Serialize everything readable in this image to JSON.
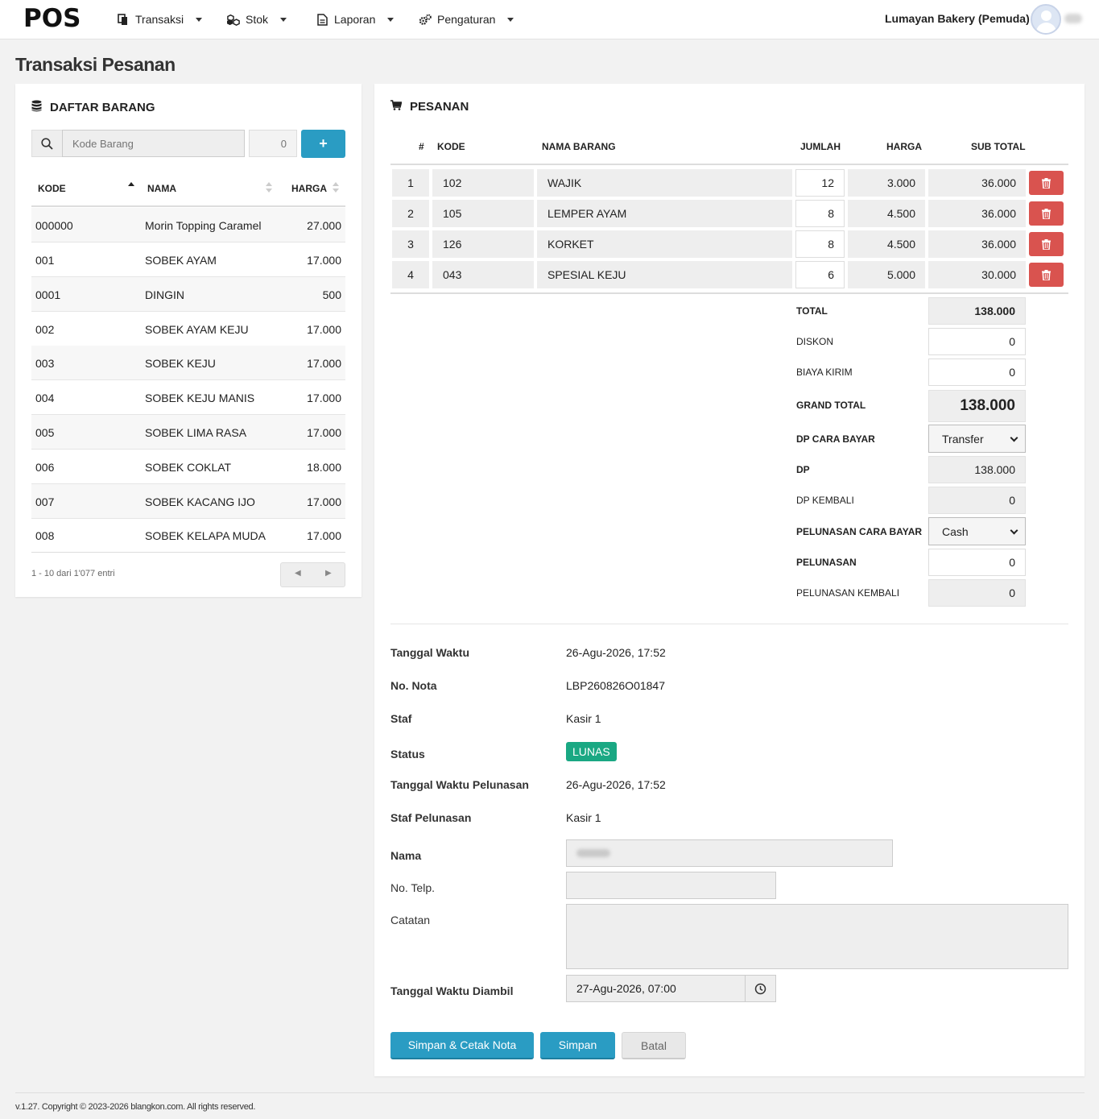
{
  "navbar": {
    "brand": "POS",
    "menu": [
      {
        "label": "Transaksi",
        "icon": "file-copy-icon"
      },
      {
        "label": "Stok",
        "icon": "cubes-icon"
      },
      {
        "label": "Laporan",
        "icon": "file-text-icon"
      },
      {
        "label": "Pengaturan",
        "icon": "cogs-icon"
      }
    ],
    "store_name": "Lumayan Bakery (Pemuda)"
  },
  "page_title": "Transaksi Pesanan",
  "item_list": {
    "title": "DAFTAR BARANG",
    "search_placeholder": "Kode Barang",
    "qty_value": "0",
    "add_label": "+",
    "columns": [
      "KODE",
      "NAMA",
      "HARGA"
    ],
    "rows": [
      {
        "kode": "000000",
        "nama": "Morin Topping Caramel",
        "harga": "27.000"
      },
      {
        "kode": "001",
        "nama": "SOBEK AYAM",
        "harga": "17.000"
      },
      {
        "kode": "0001",
        "nama": "DINGIN",
        "harga": "500"
      },
      {
        "kode": "002",
        "nama": "SOBEK AYAM KEJU",
        "harga": "17.000"
      },
      {
        "kode": "003",
        "nama": "SOBEK KEJU",
        "harga": "17.000"
      },
      {
        "kode": "004",
        "nama": "SOBEK KEJU MANIS",
        "harga": "17.000"
      },
      {
        "kode": "005",
        "nama": "SOBEK LIMA RASA",
        "harga": "17.000"
      },
      {
        "kode": "006",
        "nama": "SOBEK COKLAT",
        "harga": "18.000"
      },
      {
        "kode": "007",
        "nama": "SOBEK KACANG IJO",
        "harga": "17.000"
      },
      {
        "kode": "008",
        "nama": "SOBEK KELAPA MUDA",
        "harga": "17.000"
      }
    ],
    "info": "1 - 10 dari 1'077 entri"
  },
  "order": {
    "title": "PESANAN",
    "columns": [
      "#",
      "KODE",
      "NAMA BARANG",
      "JUMLAH",
      "HARGA",
      "SUB TOTAL"
    ],
    "rows": [
      {
        "no": "1",
        "kode": "102",
        "nama": "WAJIK",
        "jumlah": "12",
        "harga": "3.000",
        "subtotal": "36.000"
      },
      {
        "no": "2",
        "kode": "105",
        "nama": "LEMPER AYAM",
        "jumlah": "8",
        "harga": "4.500",
        "subtotal": "36.000"
      },
      {
        "no": "3",
        "kode": "126",
        "nama": "KORKET",
        "jumlah": "8",
        "harga": "4.500",
        "subtotal": "36.000"
      },
      {
        "no": "4",
        "kode": "043",
        "nama": "SPESIAL KEJU",
        "jumlah": "6",
        "harga": "5.000",
        "subtotal": "30.000"
      }
    ],
    "summary": {
      "total_label": "TOTAL",
      "total": "138.000",
      "diskon_label": "DISKON",
      "diskon": "0",
      "biaya_kirim_label": "BIAYA KIRIM",
      "biaya_kirim": "0",
      "grand_total_label": "GRAND TOTAL",
      "grand_total": "138.000",
      "dp_cara_bayar_label": "DP CARA BAYAR",
      "dp_cara_bayar": "Transfer",
      "dp_label": "DP",
      "dp": "138.000",
      "dp_kembali_label": "DP KEMBALI",
      "dp_kembali": "0",
      "pelunasan_cara_bayar_label": "PELUNASAN CARA BAYAR",
      "pelunasan_cara_bayar": "Cash",
      "pelunasan_label": "PELUNASAN",
      "pelunasan": "0",
      "pelunasan_kembali_label": "PELUNASAN KEMBALI",
      "pelunasan_kembali": "0"
    },
    "details": {
      "tanggal_waktu_label": "Tanggal Waktu",
      "tanggal_waktu": "26-Agu-2026, 17:52",
      "no_nota_label": "No. Nota",
      "no_nota": "LBP260826O01847",
      "staf_label": "Staf",
      "staf": "Kasir 1",
      "status_label": "Status",
      "status": "LUNAS",
      "tanggal_pelunasan_label": "Tanggal Waktu Pelunasan",
      "tanggal_pelunasan": "26-Agu-2026, 17:52",
      "staf_pelunasan_label": "Staf Pelunasan",
      "staf_pelunasan": "Kasir 1",
      "nama_label": "Nama",
      "telp_label": "No. Telp.",
      "catatan_label": "Catatan",
      "diambil_label": "Tanggal Waktu Diambil",
      "diambil": "27-Agu-2026, 07:00"
    },
    "buttons": {
      "simpan_cetak": "Simpan & Cetak Nota",
      "simpan": "Simpan",
      "batal": "Batal"
    },
    "colors": {
      "primary": "#2a9cc3",
      "danger": "#d9534f",
      "success": "#1aa883"
    }
  },
  "footer": {
    "copyright": "v.1.27. Copyright © 2023-2026 blangkon.com. All rights reserved."
  }
}
